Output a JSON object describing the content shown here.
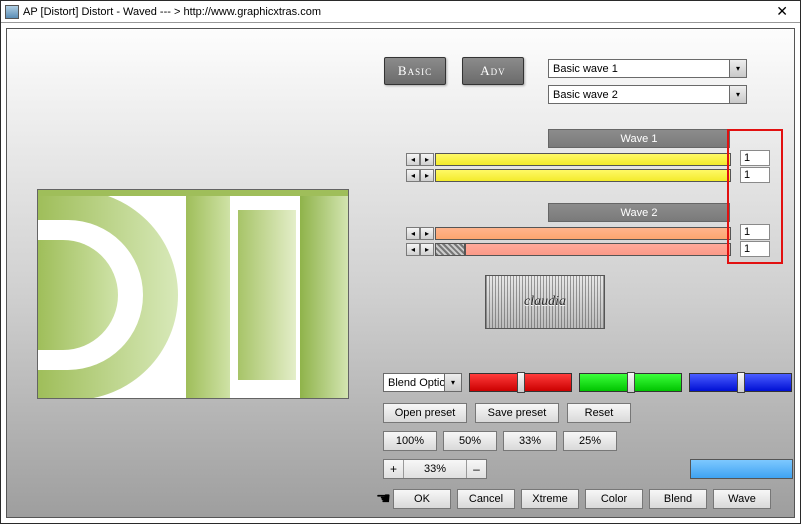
{
  "titlebar": {
    "title": "AP [Distort]  Distort - Waved    --- >  http://www.graphicxtras.com",
    "close": "✕"
  },
  "tabs": {
    "basic": "Basic",
    "adv": "Adv"
  },
  "presets": {
    "combo1": "Basic wave 1",
    "combo2": "Basic wave 2"
  },
  "wave1": {
    "header": "Wave 1",
    "val1": "1",
    "val2": "1"
  },
  "wave2": {
    "header": "Wave 2",
    "val1": "1",
    "val2": "1"
  },
  "logo": {
    "text": "claudia"
  },
  "blend": {
    "label": "Blend Optio"
  },
  "buttons": {
    "open_preset": "Open preset",
    "save_preset": "Save preset",
    "reset": "Reset",
    "p100": "100%",
    "p50": "50%",
    "p33": "33%",
    "p25": "25%"
  },
  "stepper": {
    "plus": "+",
    "value": "33%",
    "minus": "–"
  },
  "bottom": {
    "ok": "OK",
    "cancel": "Cancel",
    "xtreme": "Xtreme",
    "color": "Color",
    "blend": "Blend",
    "wave": "Wave"
  },
  "glyphs": {
    "left": "◂",
    "right": "▸",
    "down": "▾"
  }
}
